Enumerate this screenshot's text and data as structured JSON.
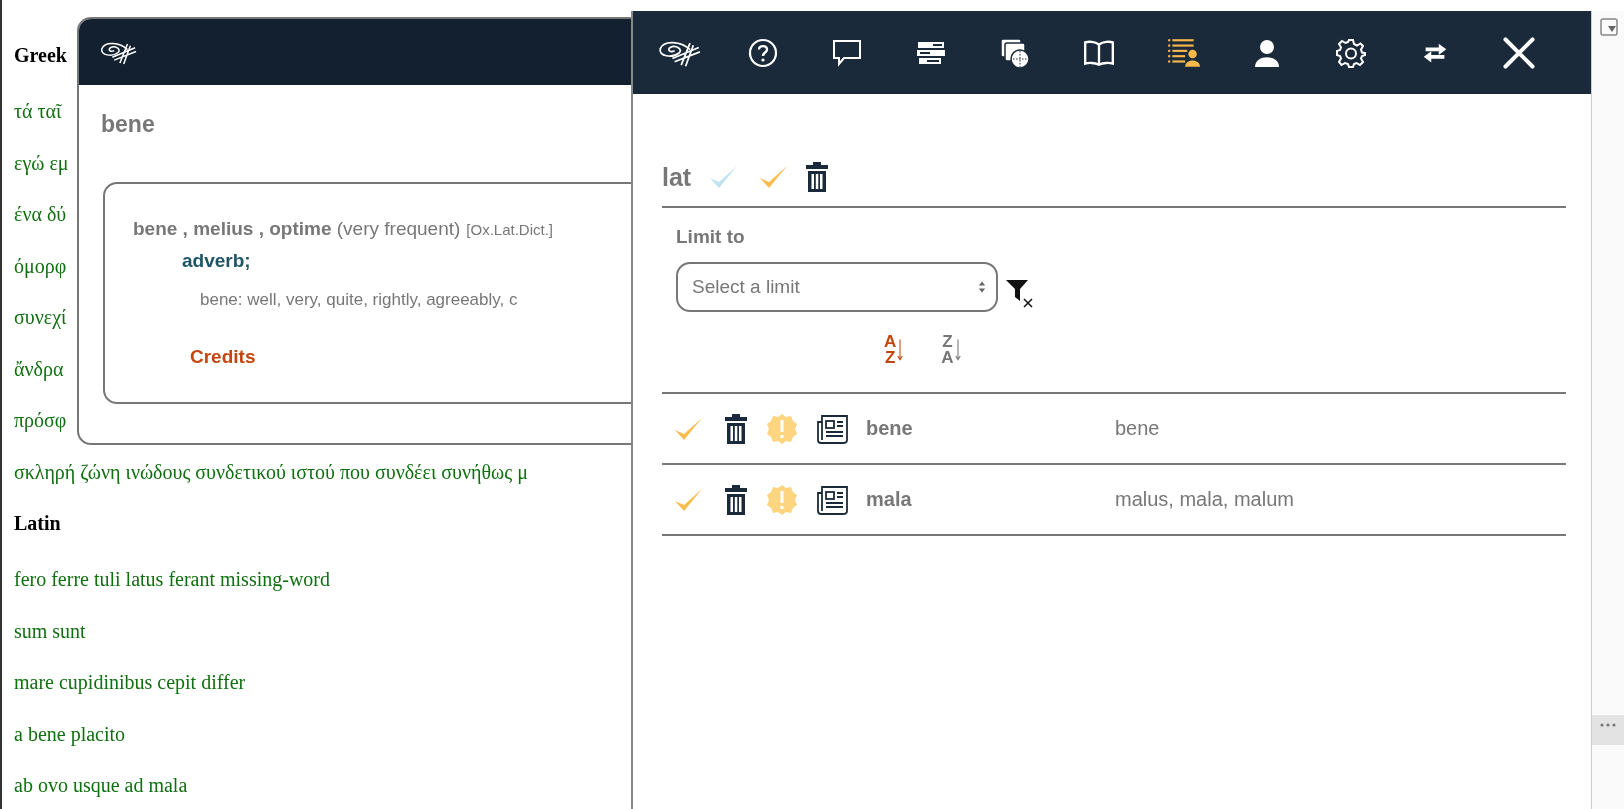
{
  "page": {
    "sections": [
      {
        "heading": "Greek",
        "lines": [
          "τά ταῖ",
          "εγώ εμ",
          "ένα δύ",
          "όμορφ",
          "συνεχί",
          "ἄνδρα",
          "πρόσφ",
          "σκληρή ζώνη ινώδους συνδετικού ιστού που συνδέει συνήθως μ"
        ]
      },
      {
        "heading": "Latin",
        "lines": [
          "fero ferre tuli latus ferant missing-word",
          "sum sunt",
          "mare cupidinibus cepit differ",
          "a bene placito",
          "ab ovo usque ad mala"
        ]
      }
    ]
  },
  "popup": {
    "word": "bene",
    "entry": {
      "headword": "**bene , melius , optime** (very frequent)",
      "source": "[Ox.Lat.Dict.]",
      "pos": "adverb;",
      "definition": "bene: well, very, quite, rightly, agreeably, c",
      "credits": "Credits"
    }
  },
  "panel": {
    "toolbar": [
      {
        "kind": "logo",
        "selected": false
      },
      {
        "kind": "help",
        "selected": false
      },
      {
        "kind": "comment",
        "selected": false
      },
      {
        "kind": "bars",
        "selected": false
      },
      {
        "kind": "layers",
        "selected": false
      },
      {
        "kind": "book",
        "selected": false
      },
      {
        "kind": "wordlist",
        "selected": true
      },
      {
        "kind": "user",
        "selected": false
      },
      {
        "kind": "settings",
        "selected": false
      },
      {
        "kind": "swap",
        "selected": false
      },
      {
        "kind": "close",
        "selected": false
      }
    ],
    "language": "lat",
    "limit_label": "Limit to",
    "limit_select": {
      "placeholder": "Select a limit"
    },
    "sort": [
      {
        "top": "A",
        "bottom": "Z",
        "selected": true
      },
      {
        "top": "Z",
        "bottom": "A",
        "selected": false
      }
    ],
    "words": [
      {
        "word": "bene",
        "lemmas": "bene"
      },
      {
        "word": "mala",
        "lemmas": "malus, mala, malum"
      }
    ]
  }
}
